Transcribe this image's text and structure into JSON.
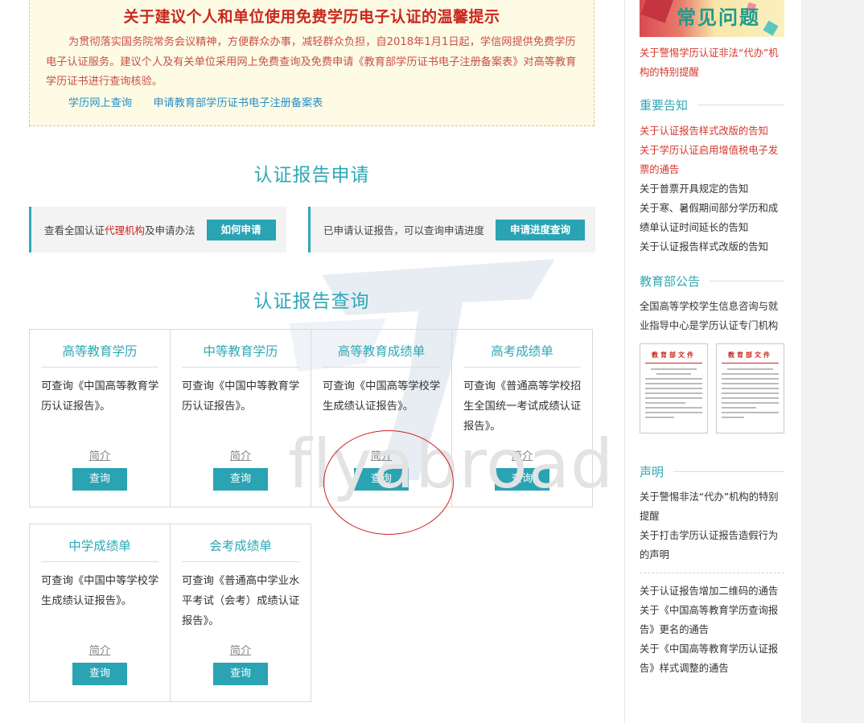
{
  "notice": {
    "title": "关于建议个人和单位使用免费学历电子认证的温馨提示",
    "body": "为贯彻落实国务院常务会议精神，方便群众办事，减轻群众负担，自2018年1月1日起，学信网提供免费学历电子认证服务。建议个人及有关单位采用网上免费查询及免费申请《教育部学历证书电子注册备案表》对高等教育学历证书进行查询核验。",
    "link1": "学历网上查询",
    "link2": "申请教育部学历证书电子注册备案表"
  },
  "apply": {
    "title": "认证报告申请",
    "box1_prefix": "查看全国认证",
    "box1_highlight": "代理机构",
    "box1_suffix": "及申请办法",
    "box1_button": "如何申请",
    "box2_text": "已申请认证报告，可以查询申请进度",
    "box2_button": "申请进度查询"
  },
  "query": {
    "title": "认证报告查询",
    "intro_label": "简介",
    "button_label": "查询",
    "cards": [
      {
        "title": "高等教育学历",
        "desc": "可查询《中国高等教育学历认证报告》。"
      },
      {
        "title": "中等教育学历",
        "desc": "可查询《中国中等教育学历认证报告》。"
      },
      {
        "title": "高等教育成绩单",
        "desc": "可查询《中国高等学校学生成绩认证报告》。"
      },
      {
        "title": "高考成绩单",
        "desc": "可查询《普通高等学校招生全国统一考试成绩认证报告》。"
      },
      {
        "title": "中学成绩单",
        "desc": "可查询《中国中等学校学生成绩认证报告》。"
      },
      {
        "title": "会考成绩单",
        "desc": "可查询《普通高中学业水平考试（会考）成绩认证报告》。"
      }
    ]
  },
  "watermark": "flyabroad",
  "sidebar": {
    "faq_title": "常见问题",
    "faq_link": "关于警惕学历认证非法“代办”机构的特别提醒",
    "important_title": "重要告知",
    "important_links": [
      "关于认证报告样式改版的告知",
      "关于学历认证启用增值税电子发票的通告",
      "关于普票开具规定的告知",
      "关于寒、暑假期间部分学历和成绩单认证时间延长的告知",
      "关于认证报告样式改版的告知"
    ],
    "moe_title": "教育部公告",
    "moe_text": "全国高等学校学生信息咨询与就业指导中心是学历认证专门机构",
    "doc_label": "教育部文件",
    "statement_title": "声明",
    "statement_links": [
      "关于警惕非法“代办”机构的特别提醒",
      "关于打击学历认证报告造假行为的声明"
    ],
    "bottom_links": [
      "关于认证报告增加二维码的通告",
      "关于《中国高等教育学历查询报告》更名的通告",
      "关于《中国高等教育学历认证报告》样式调整的通告"
    ]
  },
  "colors": {
    "accent": "#2fa8b5",
    "button": "#2aa3b3",
    "alert_red": "#c9271e",
    "link_red": "#d5372b"
  }
}
